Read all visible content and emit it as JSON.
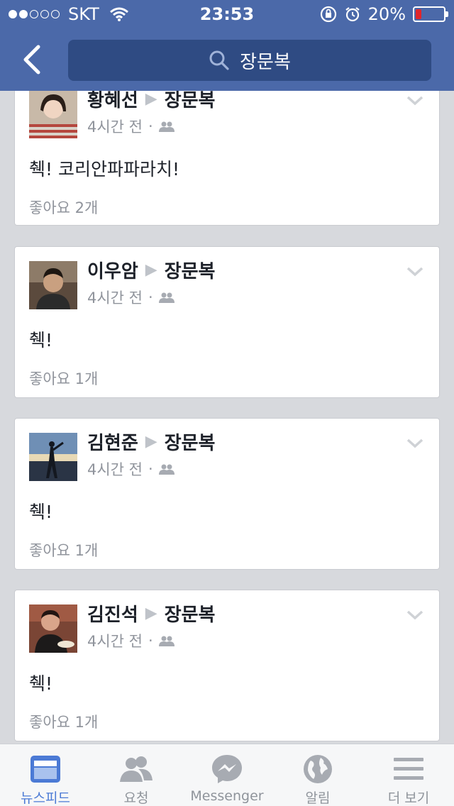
{
  "status_bar": {
    "carrier": "SKT",
    "time": "23:53",
    "battery": "20%",
    "battery_level": 0.2,
    "signal_bars_filled": 2,
    "signal_bars_total": 5
  },
  "header": {
    "search_text": "장문복",
    "colors": {
      "bar": "#4b69a9",
      "search_field": "#2f4b83"
    }
  },
  "posts": [
    {
      "author": "황혜선",
      "target": "장문복",
      "time": "4시간 전",
      "text": "췍! 코리안파파라치!",
      "likes": "좋아요 2개"
    },
    {
      "author": "이우암",
      "target": "장문복",
      "time": "4시간 전",
      "text": "췍!",
      "likes": "좋아요 1개"
    },
    {
      "author": "김현준",
      "target": "장문복",
      "time": "4시간 전",
      "text": "췍!",
      "likes": "좋아요 1개"
    },
    {
      "author": "김진석",
      "target": "장문복",
      "time": "4시간 전",
      "text": "췍!",
      "likes": "좋아요 1개"
    }
  ],
  "tabbar": {
    "tabs": [
      {
        "label": "뉴스피드",
        "icon": "news-feed-icon",
        "active": true
      },
      {
        "label": "요청",
        "icon": "friend-requests-icon",
        "active": false
      },
      {
        "label": "Messenger",
        "icon": "messenger-icon",
        "active": false
      },
      {
        "label": "알림",
        "icon": "globe-icon",
        "active": false
      },
      {
        "label": "더 보기",
        "icon": "menu-icon",
        "active": false
      }
    ],
    "colors": {
      "active": "#4b7ad5",
      "inactive": "#8f949b"
    }
  }
}
